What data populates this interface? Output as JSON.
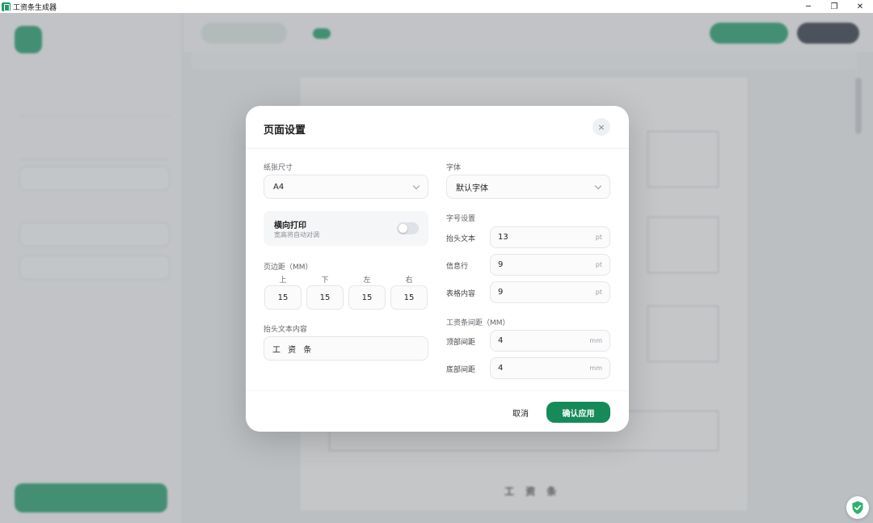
{
  "window": {
    "title": "工资条生成器"
  },
  "modal": {
    "title": "页面设置",
    "paper_size": {
      "label": "纸张尺寸",
      "value": "A4"
    },
    "font": {
      "label": "字体",
      "value": "默认字体"
    },
    "landscape": {
      "title": "横向打印",
      "hint": "宽高将自动对调",
      "enabled": false
    },
    "margins": {
      "label": "页边距（MM）",
      "items": [
        {
          "label": "上",
          "value": "15"
        },
        {
          "label": "下",
          "value": "15"
        },
        {
          "label": "左",
          "value": "15"
        },
        {
          "label": "右",
          "value": "15"
        }
      ]
    },
    "header_text": {
      "label": "抬头文本内容",
      "value": "工 资 条"
    },
    "font_sizes": {
      "label": "字号设置",
      "items": [
        {
          "label": "抬头文本",
          "value": "13",
          "unit": "pt"
        },
        {
          "label": "信息行",
          "value": "9",
          "unit": "pt"
        },
        {
          "label": "表格内容",
          "value": "9",
          "unit": "pt"
        }
      ]
    },
    "spacing": {
      "label": "工资条间距（MM）",
      "items": [
        {
          "label": "顶部间距",
          "value": "4",
          "unit": "mm"
        },
        {
          "label": "底部间距",
          "value": "4",
          "unit": "mm"
        }
      ]
    },
    "cancel_label": "取消",
    "apply_label": "确认应用",
    "close_glyph": "×"
  },
  "background": {
    "slip_title": "工 资 条"
  },
  "colors": {
    "accent": "#178a5a",
    "brand": "#1f9d6b"
  },
  "icons": [
    "app-icon",
    "minimize-icon",
    "restore-icon",
    "close-icon",
    "chevron-down-icon",
    "shield-check-icon"
  ]
}
